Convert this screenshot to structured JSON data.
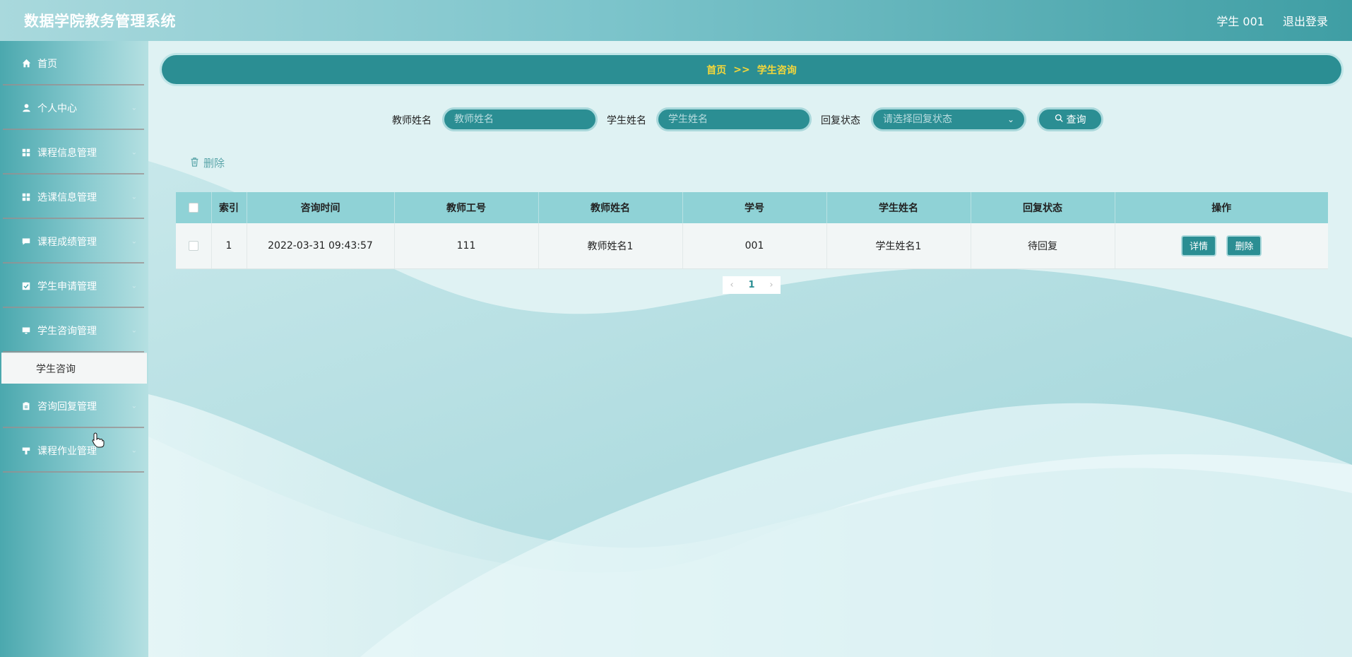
{
  "header": {
    "app_title": "数据学院教务管理系统",
    "user": "学生 001",
    "logout": "退出登录"
  },
  "sidebar": {
    "items": [
      {
        "label": "首页",
        "icon": "home-icon",
        "has_chevron": false
      },
      {
        "label": "个人中心",
        "icon": "user-icon",
        "has_chevron": true
      },
      {
        "label": "课程信息管理",
        "icon": "grid-icon",
        "has_chevron": true
      },
      {
        "label": "选课信息管理",
        "icon": "grid-icon",
        "has_chevron": true
      },
      {
        "label": "课程成绩管理",
        "icon": "message-icon",
        "has_chevron": true
      },
      {
        "label": "学生申请管理",
        "icon": "checkbox-icon",
        "has_chevron": true
      },
      {
        "label": "学生咨询管理",
        "icon": "monitor-icon",
        "has_chevron": true
      },
      {
        "label": "咨询回复管理",
        "icon": "clipboard-icon",
        "has_chevron": true
      },
      {
        "label": "课程作业管理",
        "icon": "stamp-icon",
        "has_chevron": true
      }
    ],
    "submenu": {
      "label": "学生咨询"
    }
  },
  "breadcrumb": {
    "home": "首页",
    "separator": ">>",
    "current": "学生咨询"
  },
  "search": {
    "teacher_label": "教师姓名",
    "teacher_placeholder": "教师姓名",
    "student_label": "学生姓名",
    "student_placeholder": "学生姓名",
    "reply_label": "回复状态",
    "reply_placeholder": "请选择回复状态",
    "button": "查询"
  },
  "actions": {
    "delete": "删除"
  },
  "table": {
    "headers": [
      "索引",
      "咨询时间",
      "教师工号",
      "教师姓名",
      "学号",
      "学生姓名",
      "回复状态",
      "操作"
    ],
    "rows": [
      {
        "index": "1",
        "time": "2022-03-31 09:43:57",
        "teacher_id": "111",
        "teacher_name": "教师姓名1",
        "student_id": "001",
        "student_name": "学生姓名1",
        "status": "待回复",
        "detail_btn": "详情",
        "delete_btn": "删除"
      }
    ]
  },
  "pagination": {
    "prev": "‹",
    "current": "1",
    "next": "›"
  },
  "colors": {
    "accent": "#2b8e93",
    "breadcrumb_text": "#f5d73a",
    "header_gradient_end": "#3f9ea4",
    "table_header": "#8fd2d6"
  }
}
